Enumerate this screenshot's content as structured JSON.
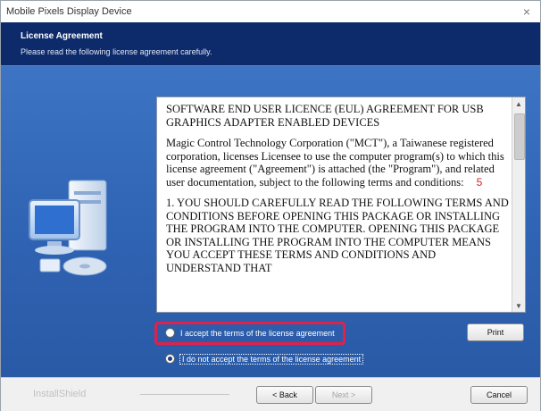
{
  "window": {
    "title": "Mobile Pixels Display Device",
    "close_glyph": "×"
  },
  "header": {
    "title": "License Agreement",
    "subtitle": "Please read the following license agreement carefully."
  },
  "license": {
    "paragraphs": [
      "SOFTWARE END USER LICENCE (EUL) AGREEMENT FOR USB GRAPHICS ADAPTER ENABLED DEVICES",
      "Magic Control Technology Corporation (\"MCT\"), a Taiwanese registered corporation, licenses Licensee to use the computer program(s) to which this license agreement (\"Agreement\") is attached (the \"Program\"), and related user documentation, subject to the following terms and conditions:",
      "1. YOU SHOULD CAREFULLY READ THE FOLLOWING TERMS AND CONDITIONS BEFORE OPENING THIS PACKAGE OR INSTALLING THE PROGRAM INTO THE COMPUTER. OPENING THIS PACKAGE OR INSTALLING THE PROGRAM INTO THE COMPUTER MEANS YOU ACCEPT THESE TERMS AND CONDITIONS AND UNDERSTAND THAT"
    ],
    "step_marker": "5"
  },
  "options": {
    "accept_label": "I accept the terms of the license agreement",
    "decline_label": "I do not accept the terms of the license agreement",
    "selected": "decline"
  },
  "buttons": {
    "print": "Print",
    "back": "< Back",
    "next": "Next >",
    "cancel": "Cancel"
  },
  "footer": {
    "brand": "InstallShield"
  },
  "colors": {
    "header_bg": "#0d2b6b",
    "panel_bg": "#3d74c4",
    "highlight": "#e0224a"
  }
}
